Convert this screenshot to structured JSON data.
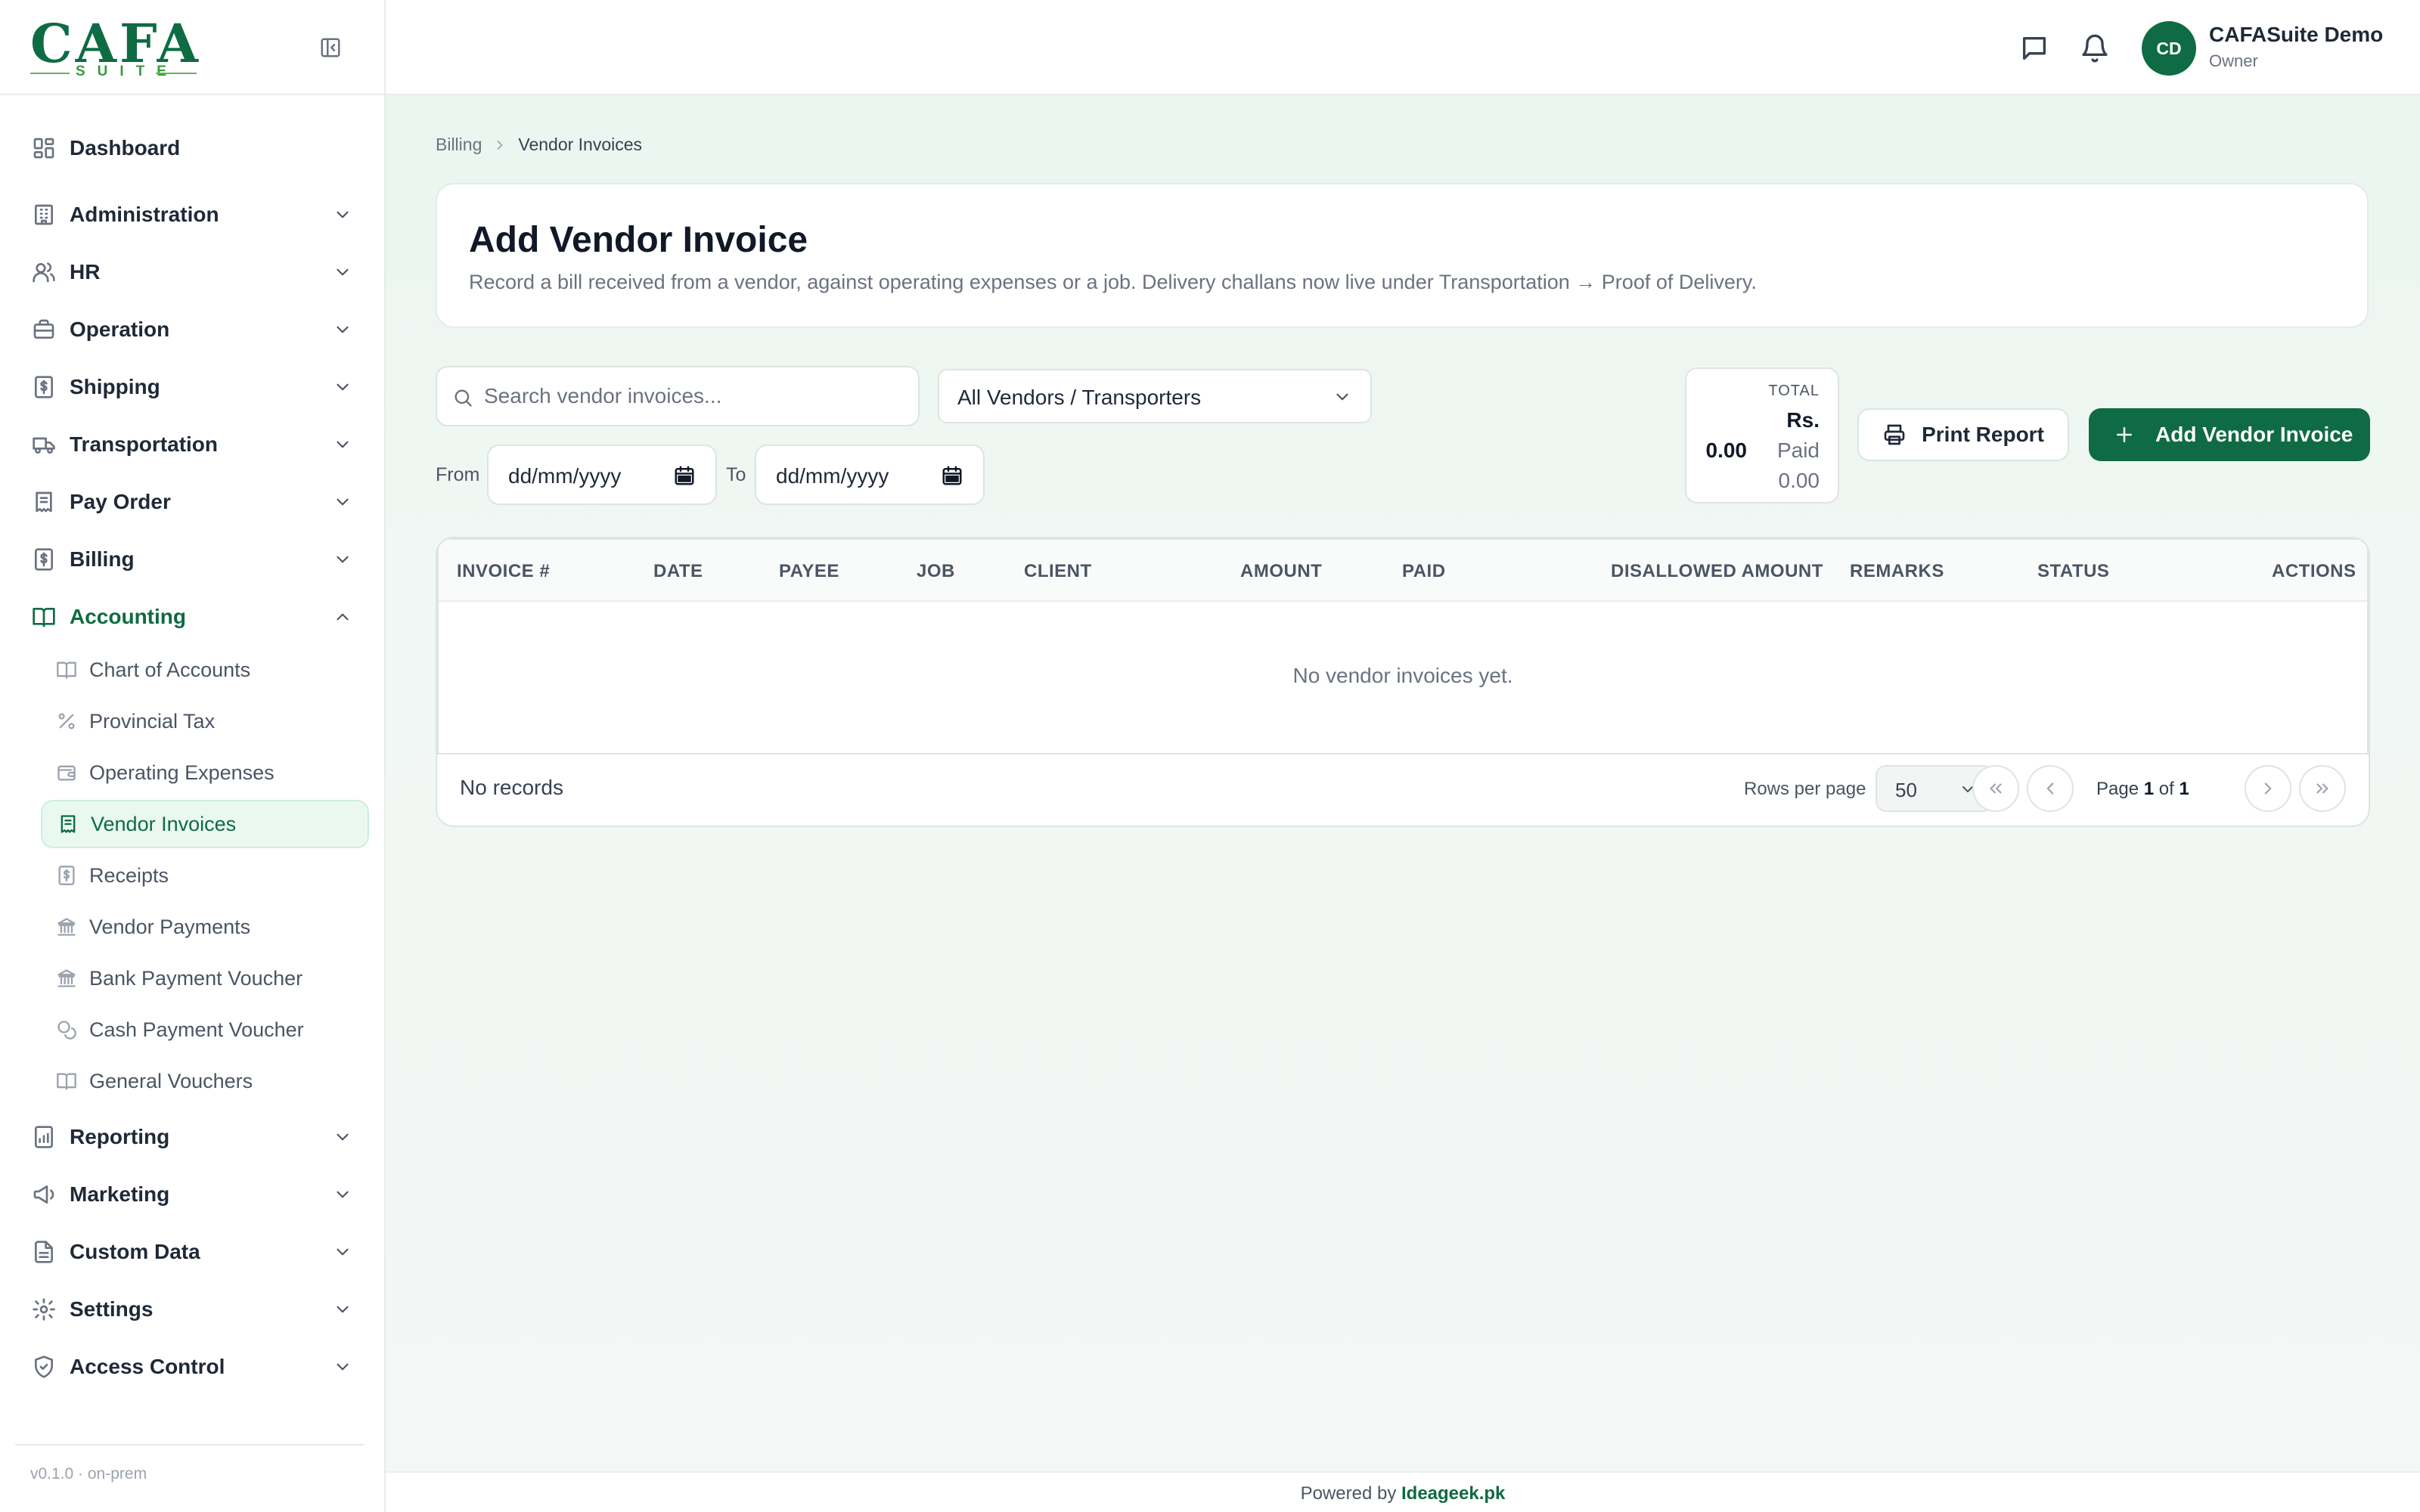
{
  "brand": {
    "logo_text": "CAFA",
    "logo_sub": "SUITE"
  },
  "sidebar": {
    "items": [
      {
        "label": "Dashboard",
        "icon": "dashboard-icon"
      },
      {
        "label": "Administration",
        "icon": "building-icon"
      },
      {
        "label": "HR",
        "icon": "users-icon"
      },
      {
        "label": "Operation",
        "icon": "briefcase-icon"
      },
      {
        "label": "Shipping",
        "icon": "dollar-doc-icon"
      },
      {
        "label": "Transportation",
        "icon": "truck-icon"
      },
      {
        "label": "Pay Order",
        "icon": "receipt-icon"
      },
      {
        "label": "Billing",
        "icon": "dollar-doc-icon"
      },
      {
        "label": "Accounting",
        "icon": "book-open-icon"
      },
      {
        "label": "Reporting",
        "icon": "chart-doc-icon"
      },
      {
        "label": "Marketing",
        "icon": "megaphone-icon"
      },
      {
        "label": "Custom Data",
        "icon": "document-icon"
      },
      {
        "label": "Settings",
        "icon": "gear-icon"
      },
      {
        "label": "Access Control",
        "icon": "shield-icon"
      }
    ],
    "accounting_sub": [
      {
        "label": "Chart of Accounts",
        "icon": "book-open-icon"
      },
      {
        "label": "Provincial Tax",
        "icon": "percent-icon"
      },
      {
        "label": "Operating Expenses",
        "icon": "wallet-icon"
      },
      {
        "label": "Vendor Invoices",
        "icon": "receipt-icon"
      },
      {
        "label": "Receipts",
        "icon": "dollar-doc-icon"
      },
      {
        "label": "Vendor Payments",
        "icon": "bank-icon"
      },
      {
        "label": "Bank Payment Voucher",
        "icon": "bank-icon"
      },
      {
        "label": "Cash Payment Voucher",
        "icon": "coins-icon"
      },
      {
        "label": "General Vouchers",
        "icon": "book-open-icon"
      }
    ],
    "footer": "v0.1.0 · on-prem"
  },
  "header": {
    "user_initials": "CD",
    "user_name": "CAFASuite Demo",
    "user_role": "Owner"
  },
  "breadcrumb": {
    "parent": "Billing",
    "current": "Vendor Invoices"
  },
  "page": {
    "title": "Add Vendor Invoice",
    "description": "Record a bill received from a vendor, against operating expenses or a job. Delivery challans now live under Transportation → Proof of Delivery."
  },
  "filters": {
    "search_placeholder": "Search vendor invoices...",
    "vendor_selected": "All Vendors / Transporters",
    "from_label": "From",
    "to_label": "To",
    "date_placeholder": "dd/mm/yyyy"
  },
  "totals": {
    "label": "TOTAL",
    "currency": "Rs.",
    "amount": "0.00",
    "paid_label": "Paid",
    "paid_amount": "0.00"
  },
  "actions": {
    "print_label": "Print Report",
    "add_label": "Add Vendor Invoice"
  },
  "table": {
    "columns": [
      "INVOICE #",
      "DATE",
      "PAYEE",
      "JOB",
      "CLIENT",
      "AMOUNT",
      "PAID",
      "DISALLOWED AMOUNT",
      "REMARKS",
      "STATUS",
      "ACTIONS"
    ],
    "empty_message": "No vendor invoices yet.",
    "records_text": "No records",
    "rows_per_page_label": "Rows per page",
    "rows_per_page": "50",
    "page_word": "Page",
    "page_current": "1",
    "page_of": "of",
    "page_total": "1"
  },
  "footer": {
    "prefix": "Powered by",
    "brand": "Ideageek.pk"
  },
  "colors": {
    "accent": "#0f6b43",
    "active_bg": "#e9f8f0",
    "page_bg": "#f1f7f4"
  }
}
